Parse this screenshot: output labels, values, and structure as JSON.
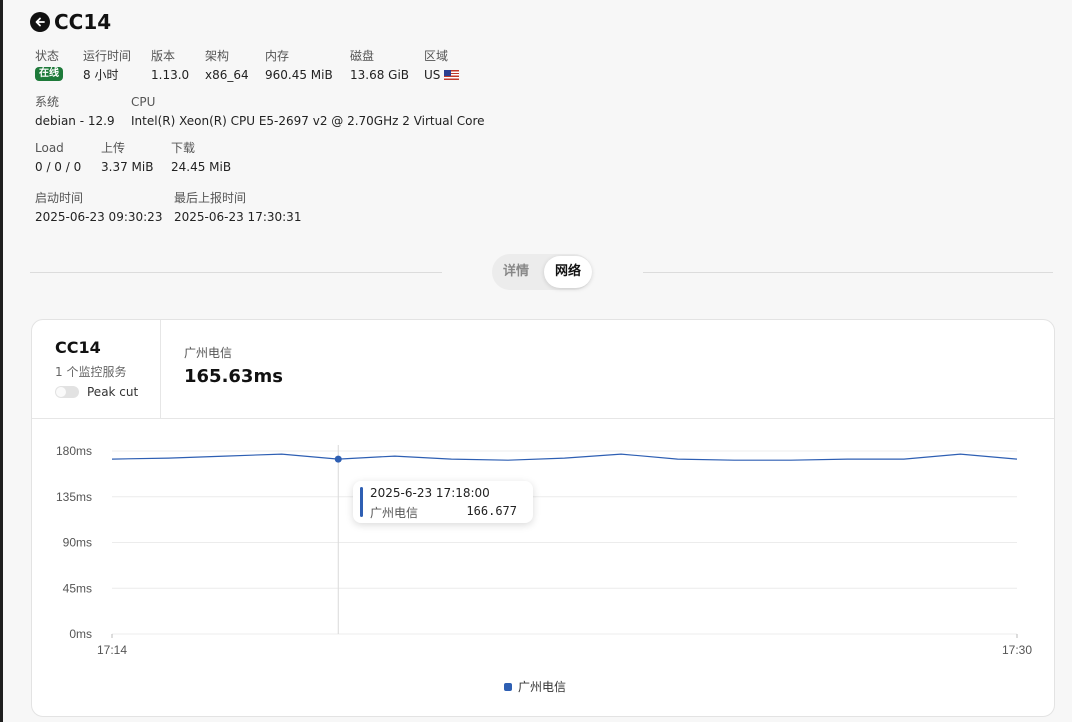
{
  "header": {
    "title": "CC14"
  },
  "info": {
    "row1": [
      {
        "label": "状态",
        "value": "在线",
        "badge": true
      },
      {
        "label": "运行时间",
        "value": "8 小时"
      },
      {
        "label": "版本",
        "value": "1.13.0"
      },
      {
        "label": "架构",
        "value": "x86_64"
      },
      {
        "label": "内存",
        "value": "960.45 MiB"
      },
      {
        "label": "磁盘",
        "value": "13.68 GiB"
      },
      {
        "label": "区域",
        "value": "US",
        "flag": true
      }
    ],
    "row2": [
      {
        "label": "系统",
        "value": "debian - 12.9"
      },
      {
        "label": "CPU",
        "value": "Intel(R) Xeon(R) CPU E5-2697 v2 @ 2.70GHz 2 Virtual Core"
      }
    ],
    "row3": [
      {
        "label": "Load",
        "value": "0 / 0 / 0"
      },
      {
        "label": "上传",
        "value": "3.37 MiB"
      },
      {
        "label": "下载",
        "value": "24.45 MiB"
      }
    ],
    "row4": [
      {
        "label": "启动时间",
        "value": "2025-06-23 09:30:23"
      },
      {
        "label": "最后上报时间",
        "value": "2025-06-23 17:30:31"
      }
    ]
  },
  "tabs": {
    "details": "详情",
    "network": "网络",
    "active": "network"
  },
  "card": {
    "server_name": "CC14",
    "monitor_count": "1 个监控服务",
    "peak_cut_label": "Peak cut",
    "peak_cut_on": false,
    "isp_label": "广州电信",
    "isp_value": "165.63ms"
  },
  "tooltip": {
    "time": "2025-6-23 17:18:00",
    "series": "广州电信",
    "value": "166.677"
  },
  "colors": {
    "series": "#2e5fb3",
    "online_badge": "#1e7a3a"
  },
  "chart_data": {
    "type": "line",
    "x": [
      "17:14",
      "17:15",
      "17:16",
      "17:17",
      "17:18",
      "17:19",
      "17:20",
      "17:21",
      "17:22",
      "17:23",
      "17:24",
      "17:25",
      "17:26",
      "17:27",
      "17:28",
      "17:29",
      "17:30"
    ],
    "x_tick_labels": [
      "17:14",
      "17:30"
    ],
    "y_tick_labels": [
      "0ms",
      "45ms",
      "90ms",
      "135ms",
      "180ms"
    ],
    "ylim": [
      0,
      180
    ],
    "series": [
      {
        "name": "广州电信",
        "values": [
          172,
          173,
          175,
          177,
          172,
          175,
          172,
          171,
          173,
          177,
          172,
          171,
          171,
          172,
          172,
          177,
          172
        ]
      }
    ],
    "highlight_index": 4,
    "grid": true,
    "legend_position": "bottom-center"
  }
}
